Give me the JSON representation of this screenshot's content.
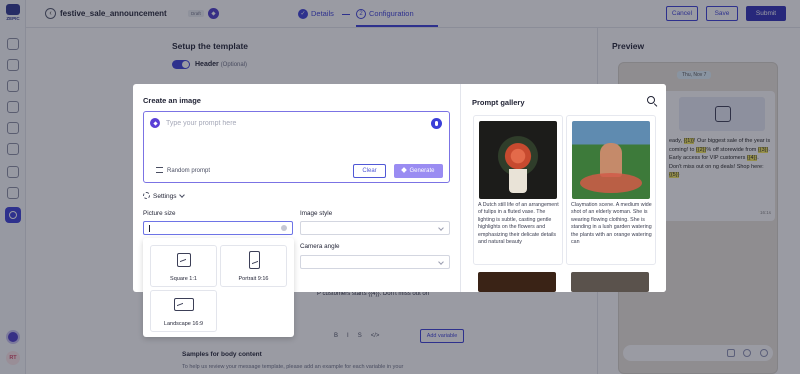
{
  "app": {
    "logo_text": "ZEPIC"
  },
  "rail": {
    "user_initials": "RT"
  },
  "header": {
    "template_name": "festive_sale_announcement",
    "draft_label": "Draft",
    "steps": [
      {
        "num": "✓",
        "label": "Details"
      },
      {
        "num": "2",
        "label": "Configuration"
      }
    ],
    "cancel_label": "Cancel",
    "save_label": "Save",
    "submit_label": "Submit"
  },
  "setup": {
    "title": "Setup the template",
    "header_label": "Header",
    "header_optional": "(Optional)",
    "body_peek": "P customers starts {{4}}. Don't miss out on",
    "format_tools": [
      "B",
      "I",
      "S",
      "</>"
    ],
    "add_variable_label": "Add variable",
    "samples_title": "Samples for body content",
    "samples_desc": "To help us review your message template, please add an example for each variable in your"
  },
  "preview": {
    "title": "Preview",
    "date": "Thu, Nov 7",
    "message_lines": [
      {
        "t": "eady, "
      },
      {
        "t": "{{1}}",
        "hl": true
      },
      {
        "t": "! Our biggest "
      },
      {
        "t": "sale of the year is coming! "
      },
      {
        "t": "to "
      },
      {
        "t": "{{2}}",
        "hl": true
      },
      {
        "t": "% off storewide from "
      },
      {
        "t": "{{3}}",
        "hl": true
      },
      {
        "t": ". Early access for VIP customers "
      },
      {
        "t": "{{4}}",
        "hl": true
      },
      {
        "t": ". Don't miss out on "
      },
      {
        "t": "ng deals! Shop here: "
      },
      {
        "t": "{{5}}",
        "hl": true
      }
    ],
    "time": "16:1s"
  },
  "modal": {
    "title": "Create an image",
    "prompt_placeholder": "Type your prompt here",
    "random_prompt_label": "Random prompt",
    "clear_label": "Clear",
    "generate_label": "Generate",
    "settings_label": "Settings",
    "picture_size_label": "Picture size",
    "image_style_label": "Image style",
    "camera_angle_label": "Camera angle",
    "size_options": [
      {
        "label": "Square 1:1"
      },
      {
        "label": "Portrait 9:16"
      },
      {
        "label": "Landscape 16:9"
      }
    ]
  },
  "gallery": {
    "title": "Prompt gallery",
    "cards": [
      {
        "text": "A Dutch still life of an arrangement of tulips in a fluted vase. The lighting is subtle, casting gentle highlights on the flowers and emphasizing their delicate details and natural beauty"
      },
      {
        "text": "Claymation scene. A medium wide shot of an elderly woman. She is wearing flowing clothing. She is standing in a lush garden watering the plants with an orange watering can"
      }
    ]
  }
}
